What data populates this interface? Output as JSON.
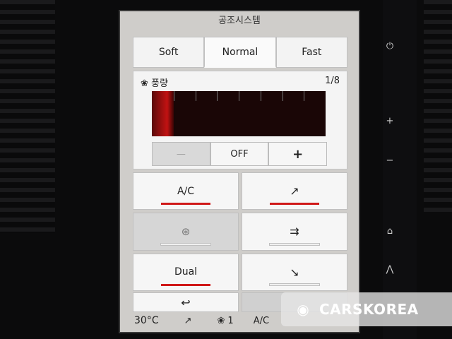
{
  "screen": {
    "title": "공조시스템"
  },
  "modes": [
    {
      "label": "Soft",
      "active": false
    },
    {
      "label": "Normal",
      "active": true
    },
    {
      "label": "Fast",
      "active": false
    }
  ],
  "fan": {
    "icon": "fan-icon",
    "label": "풍량",
    "level_text": "1/8",
    "level_fraction": 0.125,
    "minus_label": "—",
    "off_label": "OFF",
    "plus_label": "+"
  },
  "grid": {
    "ac_label": "A/C",
    "ac_on": true,
    "recirc_icon": "recirculation-icon",
    "dual_label": "Dual",
    "airflow_upper_icon": "airflow-face-icon",
    "airflow_mid_icon": "airflow-face-feet-icon",
    "airflow_lower_icon": "airflow-feet-icon",
    "back_icon": "back-arrow-icon",
    "back_glyph": "↩"
  },
  "status_bar": {
    "temp": "30°C",
    "airflow_icon": "airflow-icon",
    "fan_speed": "1",
    "ac": "A/C"
  },
  "watermark": {
    "text": "CARSKOREA"
  },
  "colors": {
    "accent_red": "#d01818",
    "panel": "#f4f4f4",
    "bezel": "#0b0b0c"
  }
}
